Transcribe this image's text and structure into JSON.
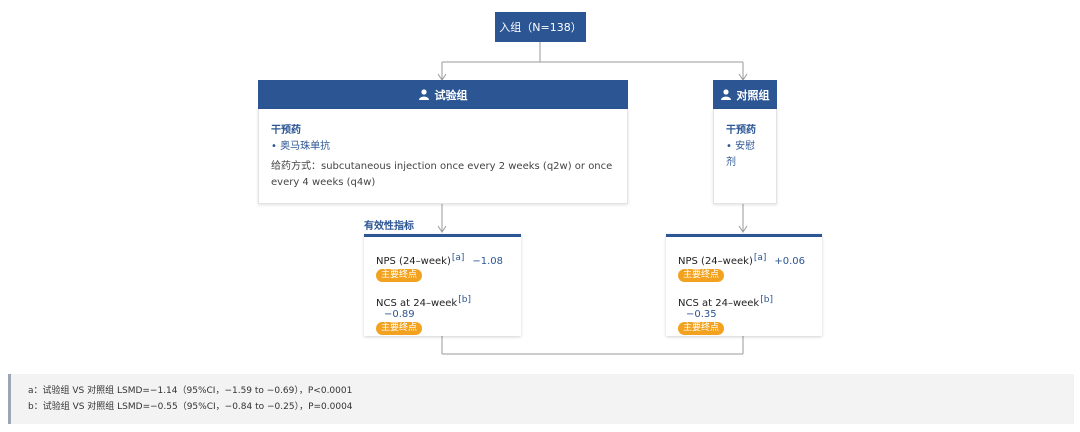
{
  "enrollment": {
    "label": "入组（N=138）"
  },
  "treatment_arm": {
    "title": "试验组",
    "intervention_heading": "干预药",
    "drug": "• 奥马珠单抗",
    "dosing": "给药方式：subcutaneous injection once every 2 weeks (q2w) or once every 4 weeks (q4w)",
    "endpoints": [
      {
        "name": "NPS (24–week)",
        "ref": "[a]",
        "value": "−1.08",
        "badge": "主要终点"
      },
      {
        "name": "NCS at 24–week",
        "ref": "[b]",
        "value": "−0.89",
        "badge": "主要终点"
      }
    ]
  },
  "control_arm": {
    "title": "对照组",
    "intervention_heading": "干预药",
    "drug": "• 安慰剂",
    "endpoints": [
      {
        "name": "NPS (24–week)",
        "ref": "[a]",
        "value": "+0.06",
        "badge": "主要终点"
      },
      {
        "name": "NCS at 24–week",
        "ref": "[b]",
        "value": "−0.35",
        "badge": "主要终点"
      }
    ]
  },
  "endpoints_label": "有效性指标",
  "footnotes": [
    "a：试验组 VS 对照组 LSMD=−1.14（95%CI，−1.59 to −0.69），P<0.0001",
    "b：试验组 VS 对照组 LSMD=−0.55（95%CI，−0.84 to −0.25），P=0.0004"
  ],
  "colors": {
    "primary": "#2b5593",
    "badge": "#f2a21f",
    "connector": "#9a9a9a"
  }
}
